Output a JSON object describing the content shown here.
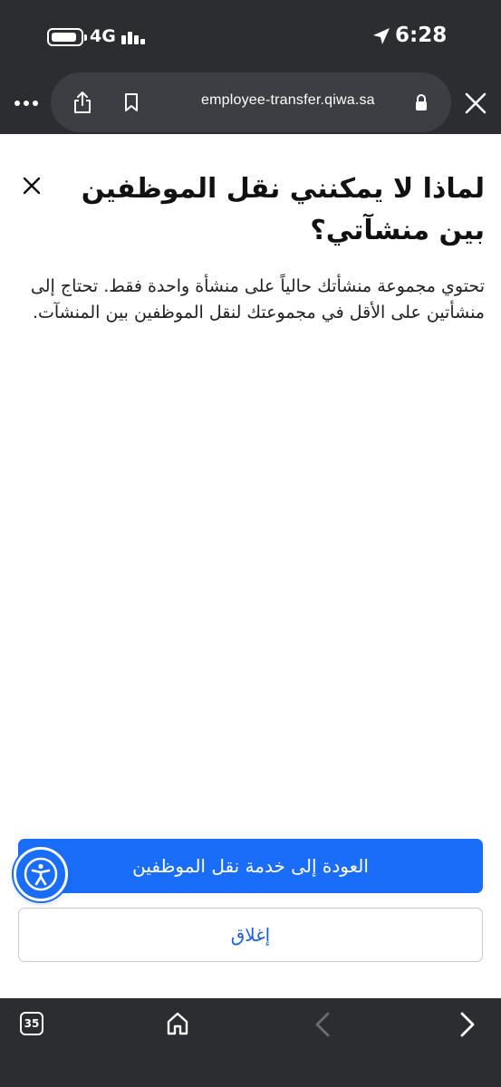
{
  "status_bar": {
    "network": "4G",
    "time": "6:28"
  },
  "browser": {
    "url": "employee-transfer.qiwa.sa"
  },
  "dialog": {
    "title": "لماذا لا يمكنني نقل الموظفين بين منشآتي؟",
    "body": "تحتوي مجموعة منشأتك حالياً على منشأة واحدة فقط. تحتاج إلى منشأتين على الأقل في مجموعتك لنقل الموظفين بين المنشآت.",
    "primary_button": "العودة إلى خدمة نقل الموظفين",
    "secondary_button": "إغلاق"
  },
  "toolbar": {
    "tab_count": "35"
  },
  "colors": {
    "chrome_bg": "#2b2d31",
    "accent": "#1a6df8",
    "link": "#1a5fdc"
  },
  "icons": [
    "battery-icon",
    "signal-icon",
    "location-arrow-icon",
    "more-icon",
    "share-icon",
    "bookmark-icon",
    "lock-icon",
    "close-icon",
    "accessibility-icon",
    "tabs-icon",
    "home-icon",
    "back-icon",
    "forward-icon"
  ]
}
